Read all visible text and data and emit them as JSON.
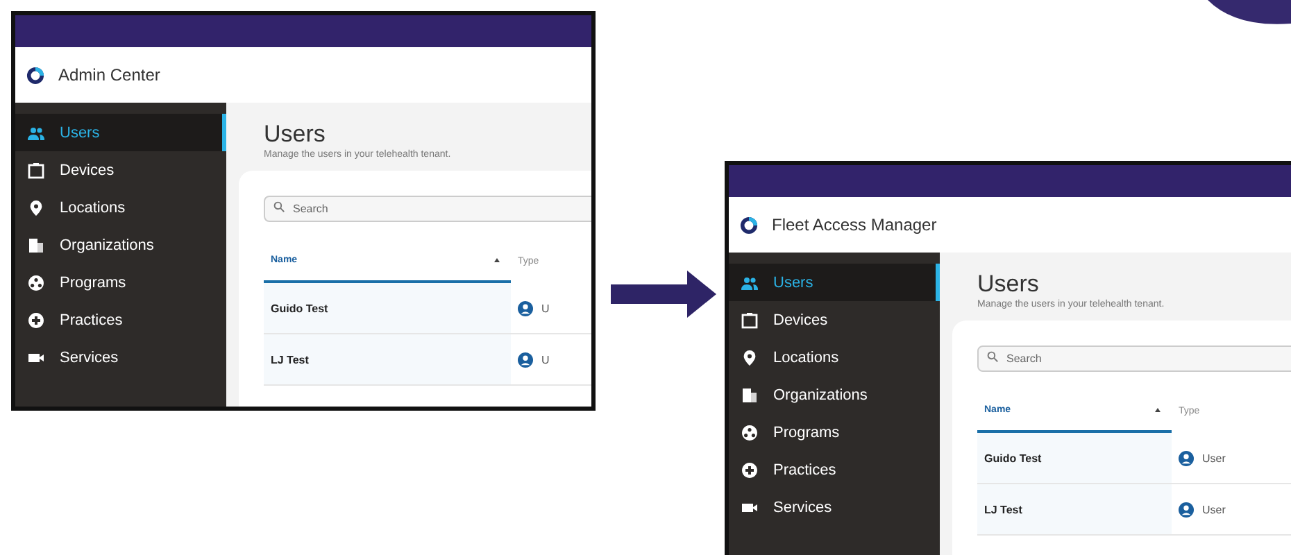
{
  "screens": [
    {
      "title": "Admin Center",
      "nav": [
        {
          "label": "Users",
          "selected": true
        },
        {
          "label": "Devices",
          "selected": false
        },
        {
          "label": "Locations",
          "selected": false
        },
        {
          "label": "Organizations",
          "selected": false
        },
        {
          "label": "Programs",
          "selected": false
        },
        {
          "label": "Practices",
          "selected": false
        },
        {
          "label": "Services",
          "selected": false
        }
      ],
      "page_title": "Users",
      "page_subtitle": "Manage the users in your telehealth tenant.",
      "search": {
        "placeholder": "Search"
      },
      "table": {
        "columns": [
          {
            "label": "Name",
            "sorted": true
          },
          {
            "label": "Type",
            "sorted": false
          }
        ],
        "rows": [
          {
            "name": "Guido Test",
            "type": "U"
          },
          {
            "name": "LJ Test",
            "type": "U"
          }
        ]
      }
    },
    {
      "title": "Fleet Access Manager",
      "nav": [
        {
          "label": "Users",
          "selected": true
        },
        {
          "label": "Devices",
          "selected": false
        },
        {
          "label": "Locations",
          "selected": false
        },
        {
          "label": "Organizations",
          "selected": false
        },
        {
          "label": "Programs",
          "selected": false
        },
        {
          "label": "Practices",
          "selected": false
        },
        {
          "label": "Services",
          "selected": false
        }
      ],
      "page_title": "Users",
      "page_subtitle": "Manage the users in your telehealth tenant.",
      "search": {
        "placeholder": "Search"
      },
      "table": {
        "columns": [
          {
            "label": "Name",
            "sorted": true
          },
          {
            "label": "Type",
            "sorted": false
          }
        ],
        "rows": [
          {
            "name": "Guido Test",
            "type": "User"
          },
          {
            "name": "LJ Test",
            "type": "User"
          }
        ]
      }
    }
  ]
}
